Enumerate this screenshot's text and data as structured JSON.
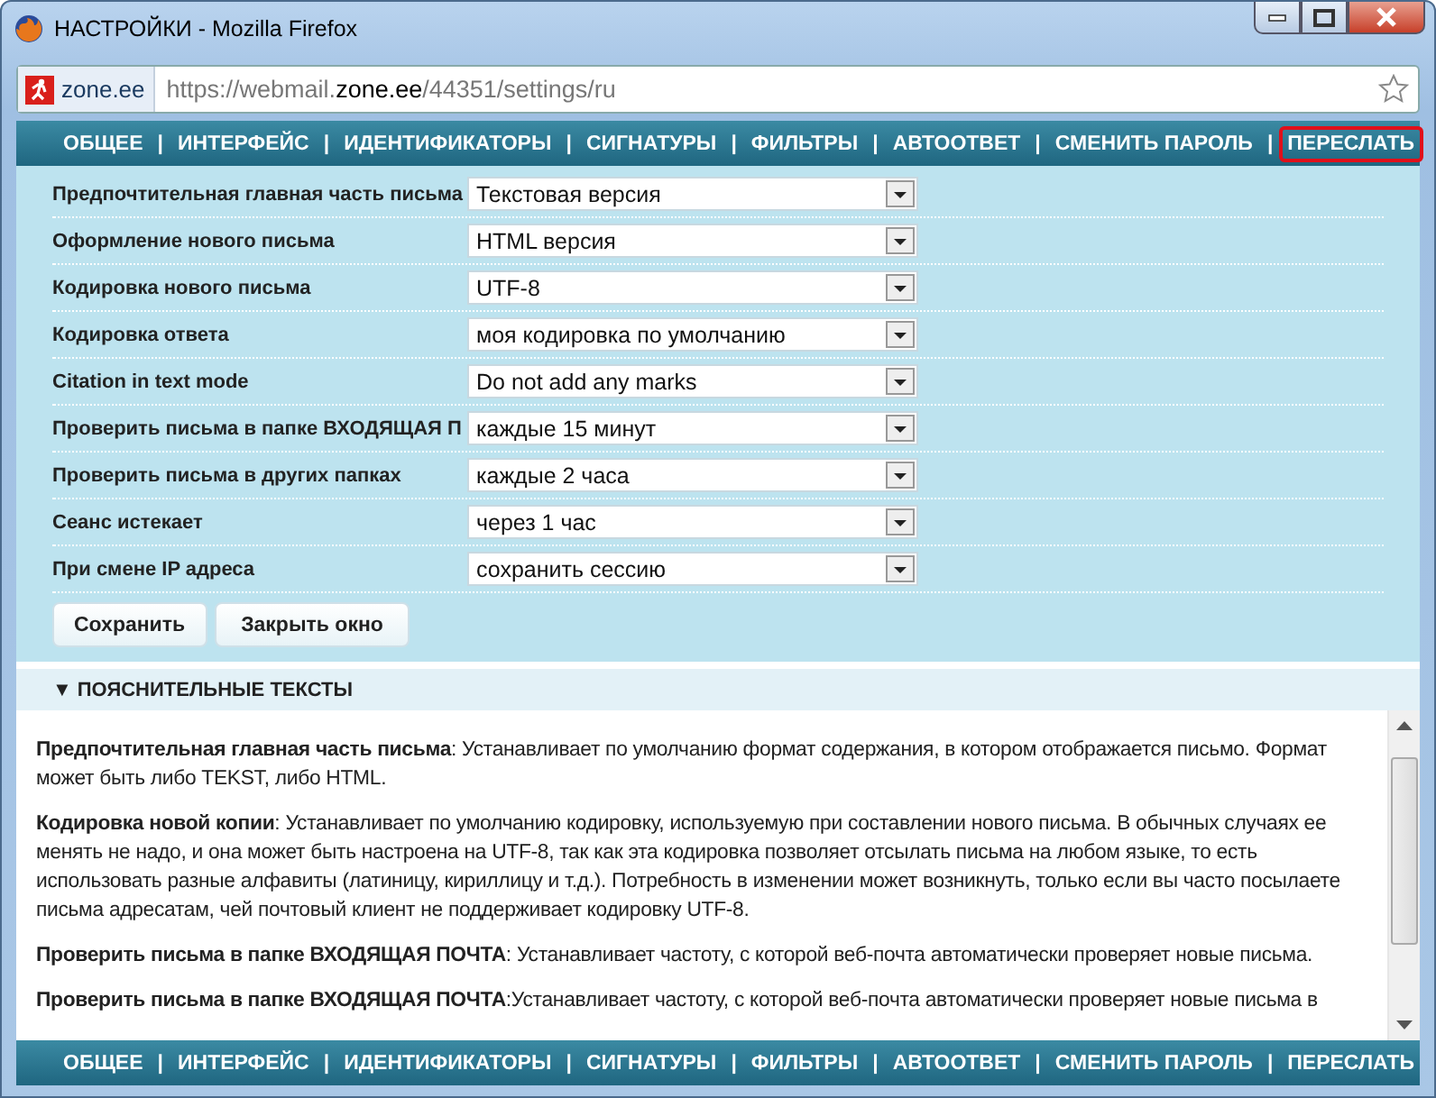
{
  "window": {
    "title": "НАСТРОЙКИ - Mozilla Firefox"
  },
  "address_bar": {
    "site_badge": "zone.ee",
    "url_prefix": "https://webmail.",
    "url_domain": "zone.ee",
    "url_path": "/44351/settings/ru"
  },
  "top_nav": [
    {
      "kind": "link",
      "label": "ОБЩЕЕ",
      "highlighted": false
    },
    {
      "kind": "separator",
      "label": "|"
    },
    {
      "kind": "link",
      "label": "ИНТЕРФЕЙС",
      "highlighted": false
    },
    {
      "kind": "separator",
      "label": "|"
    },
    {
      "kind": "link",
      "label": "ИДЕНТИФИКАТОРЫ",
      "highlighted": false
    },
    {
      "kind": "separator",
      "label": "|"
    },
    {
      "kind": "link",
      "label": "СИГНАТУРЫ",
      "highlighted": false
    },
    {
      "kind": "separator",
      "label": "|"
    },
    {
      "kind": "link",
      "label": "ФИЛЬТРЫ",
      "highlighted": false
    },
    {
      "kind": "separator",
      "label": "|"
    },
    {
      "kind": "link",
      "label": "АВТООТВЕТ",
      "highlighted": false
    },
    {
      "kind": "separator",
      "label": "|"
    },
    {
      "kind": "link",
      "label": "СМЕНИТЬ ПАРОЛЬ",
      "highlighted": false
    },
    {
      "kind": "separator",
      "label": "|"
    },
    {
      "kind": "link",
      "label": "ПЕРЕСЛАТЬ",
      "highlighted": true
    }
  ],
  "settings": [
    {
      "label": "Предпочтительная главная часть письма",
      "value": "Текстовая версия"
    },
    {
      "label": "Оформление нового письма",
      "value": "HTML версия"
    },
    {
      "label": "Кодировка нового письма",
      "value": "UTF-8"
    },
    {
      "label": "Кодировка ответа",
      "value": "моя кодировка по умолчанию"
    },
    {
      "label": "Citation in text mode",
      "value": "Do not add any marks"
    },
    {
      "label": "Проверить письма в папке ВХОДЯЩАЯ П",
      "value": "каждые 15 минут"
    },
    {
      "label": "Проверить письма в других папках",
      "value": "каждые 2 часа"
    },
    {
      "label": "Сеанс истекает",
      "value": "через 1 час"
    },
    {
      "label": "При смене IP адреса",
      "value": "сохранить сессию"
    }
  ],
  "buttons": [
    "Сохранить",
    "Закрыть окно"
  ],
  "help_section": {
    "toggle": "▼",
    "title": "ПОЯСНИТЕЛЬНЫЕ ТЕКСТЫ",
    "paragraphs": [
      "**Предпочтительная главная часть письма**: Устанавливает по умолчанию формат содержания, в котором отображается письмо. Формат может быть либо TEKST, либо HTML.",
      "**Кодировка новой копии**: Устанавливает по умолчанию кодировку, используемую при составлении нового письма. В обычных случаях ее менять не надо, и она может быть настроена на UTF-8, так как эта кодировка позволяет отсылать письма на любом языке, то есть использовать разные алфавиты (латиницу, кириллицу и т.д.). Потребность в изменении может возникнуть, только если вы часто посылаете письма адресатам, чей почтовый клиент не поддерживает кодировку UTF-8.",
      "**Проверить письма в папке ВХОДЯЩАЯ ПОЧТА**: Устанавливает частоту, с которой веб-почта автоматически проверяет новые письма.",
      "**Проверить письма в папке ВХОДЯЩАЯ ПОЧТА**:Устанавливает частоту, с которой веб-почта автоматически проверяет новые письма в"
    ]
  },
  "bottom_nav": [
    {
      "kind": "link",
      "label": "ОБЩЕЕ"
    },
    {
      "kind": "separator",
      "label": "|"
    },
    {
      "kind": "link",
      "label": "ИНТЕРФЕЙС"
    },
    {
      "kind": "separator",
      "label": "|"
    },
    {
      "kind": "link",
      "label": "ИДЕНТИФИКАТОРЫ"
    },
    {
      "kind": "separator",
      "label": "|"
    },
    {
      "kind": "link",
      "label": "СИГНАТУРЫ"
    },
    {
      "kind": "separator",
      "label": "|"
    },
    {
      "kind": "link",
      "label": "ФИЛЬТРЫ"
    },
    {
      "kind": "separator",
      "label": "|"
    },
    {
      "kind": "link",
      "label": "АВТООТВЕТ"
    },
    {
      "kind": "separator",
      "label": "|"
    },
    {
      "kind": "link",
      "label": "СМЕНИТЬ ПАРОЛЬ"
    },
    {
      "kind": "separator",
      "label": "|"
    },
    {
      "kind": "link",
      "label": "ПЕРЕСЛАТЬ"
    }
  ]
}
